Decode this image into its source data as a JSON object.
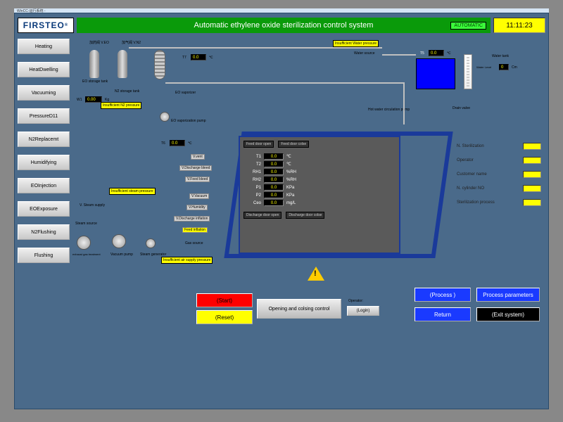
{
  "window_title": "WinCC-运行系统 -",
  "header": {
    "logo": "FIRSTEO",
    "title": "Automatic ethylene oxide sterilization control system",
    "mode": "AUTOMATIC",
    "clock": "11:11:23"
  },
  "sidebar": [
    "Heating",
    "HeatDwelling",
    "Vacuuming",
    "PressureD11",
    "N2Replacemt",
    "Humidifying",
    "EOInjection",
    "EOExposure",
    "N2Flushing",
    "Flushing"
  ],
  "callouts": {
    "water_pressure": "Insufficient Water pressure",
    "n2_pressure": "Insufficient N2 pressure",
    "steam_pressure": "Insufficient steam pressure",
    "air_supply": "Insufficient air supply pressure"
  },
  "labels": {
    "eo_valve": "加药阀  V.EO",
    "n2_valve": "加气阀  V.N2",
    "eo_tank": "EO storage tank",
    "n2_tank": "N2 storage tank",
    "w1": "W1",
    "w1_unit": "Kg",
    "eo_vaporizer": "EO vaporizer",
    "eo_vap_pump": "EO vaporization pump",
    "water_source": "Water source",
    "water_tank": "Water tank",
    "water_level": "Water Level",
    "cm": "Cm",
    "drain_valve": "Drain valve",
    "hot_pump": "Hot water circulation pump",
    "steam_supply": "V. Steam supply",
    "steam_source": "Steam source",
    "exhaust": "exhaust gas treatment",
    "vacuum_pump": "Vacuum pump",
    "steam_gen": "Steam generator",
    "gas_source": "Gas source",
    "feed_inflation": "Feed inflation",
    "v_vent": "V.vent",
    "v_disch_bleed": "V.Discharge bleed",
    "v_feed_bleed": "V.Feed bleed",
    "v_vacuum": "V.Vacuum",
    "v_humidity": "V.Humidity",
    "v_disch_infl": "V.Discharge inflation",
    "feed_open": "Feed door open",
    "feed_close": "Feed door colse",
    "disch_open": "Discharge door open",
    "disch_close": "Discharge door colse",
    "operator": "Operator:",
    "login": "(Login)",
    "opening_ctl": "Opening and colsing control"
  },
  "readings": {
    "w1": "0.00",
    "t5": "0.0",
    "t5_unit": "℃",
    "t6": "0.0",
    "t6_unit": "℃",
    "t7": "0.0",
    "t7_unit": "℃",
    "water_level": "0",
    "chamber": [
      {
        "k": "T1",
        "v": "0.0",
        "u": "℃"
      },
      {
        "k": "T2",
        "v": "0.0",
        "u": "℃"
      },
      {
        "k": "RH1",
        "v": "0.0",
        "u": "%RH"
      },
      {
        "k": "RH2",
        "v": "0.0",
        "u": "%RH"
      },
      {
        "k": "P1",
        "v": "0.0",
        "u": "KPa"
      },
      {
        "k": "P2",
        "v": "0.0",
        "u": "KPa"
      },
      {
        "k": "Ceo",
        "v": "0.0",
        "u": "mg/L"
      }
    ]
  },
  "right_panel": [
    "N. Sterilization",
    "Operator",
    "Customer name",
    "N. cylinder NO",
    "Sterilization process"
  ],
  "bottom_buttons": {
    "start": "(Start)",
    "reset": "(Reset)",
    "process": "(Process )",
    "params": "Process parameters",
    "return": "Return",
    "exit": "(Exit system)"
  }
}
